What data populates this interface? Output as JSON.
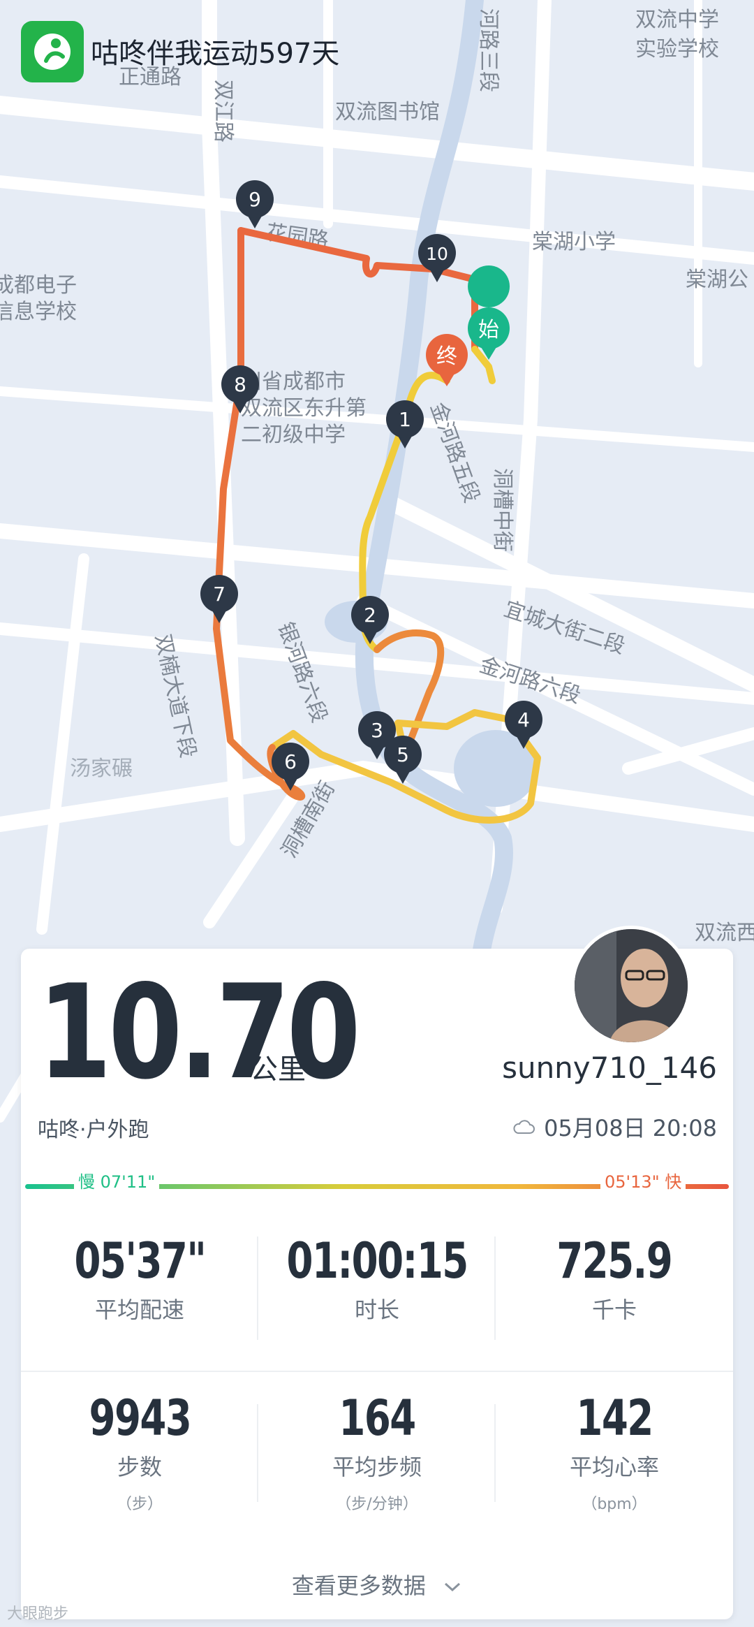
{
  "header": {
    "title": "咕咚伴我运动597天"
  },
  "map": {
    "labels": [
      "双流中学",
      "实验学校",
      "河路三段",
      "正通路",
      "双流图书馆",
      "双江路",
      "花园路",
      "棠湖小学",
      "棠湖公",
      "成都电子",
      "信息学校",
      "川省成都市",
      "双流区东升第",
      "二初级中学",
      "金河路五段",
      "洞槽中街",
      "宜城大街二段",
      "金河路六段",
      "银河路六段",
      "双楠大道下段",
      "汤家碾",
      "洞槽南街",
      "双流西"
    ],
    "markers": [
      "1",
      "2",
      "3",
      "4",
      "5",
      "6",
      "7",
      "8",
      "9",
      "10"
    ],
    "start_label": "始",
    "end_label": "终"
  },
  "summary": {
    "distance": "10.70",
    "distance_unit": "公里",
    "username": "sunny710_146",
    "sport_type": "咕咚·户外跑",
    "datetime": "05月08日 20:08",
    "pace_slow": "慢 07'11\"",
    "pace_fast": "05'13\" 快"
  },
  "stats": [
    {
      "value": "05'37\"",
      "label": "平均配速",
      "sub": ""
    },
    {
      "value": "01:00:15",
      "label": "时长",
      "sub": ""
    },
    {
      "value": "725.9",
      "label": "千卡",
      "sub": ""
    },
    {
      "value": "9943",
      "label": "步数",
      "sub": "（步）"
    },
    {
      "value": "164",
      "label": "平均步频",
      "sub": "（步/分钟）"
    },
    {
      "value": "142",
      "label": "平均心率",
      "sub": "（bpm）"
    }
  ],
  "footer": {
    "more_label": "查看更多数据",
    "watermark": "大眼跑步"
  },
  "colors": {
    "brand": "#23b34a",
    "slow": "#1fbf86",
    "fast": "#e8653e",
    "route_slow": "#f0cc3a",
    "route_fast": "#e9683f"
  }
}
